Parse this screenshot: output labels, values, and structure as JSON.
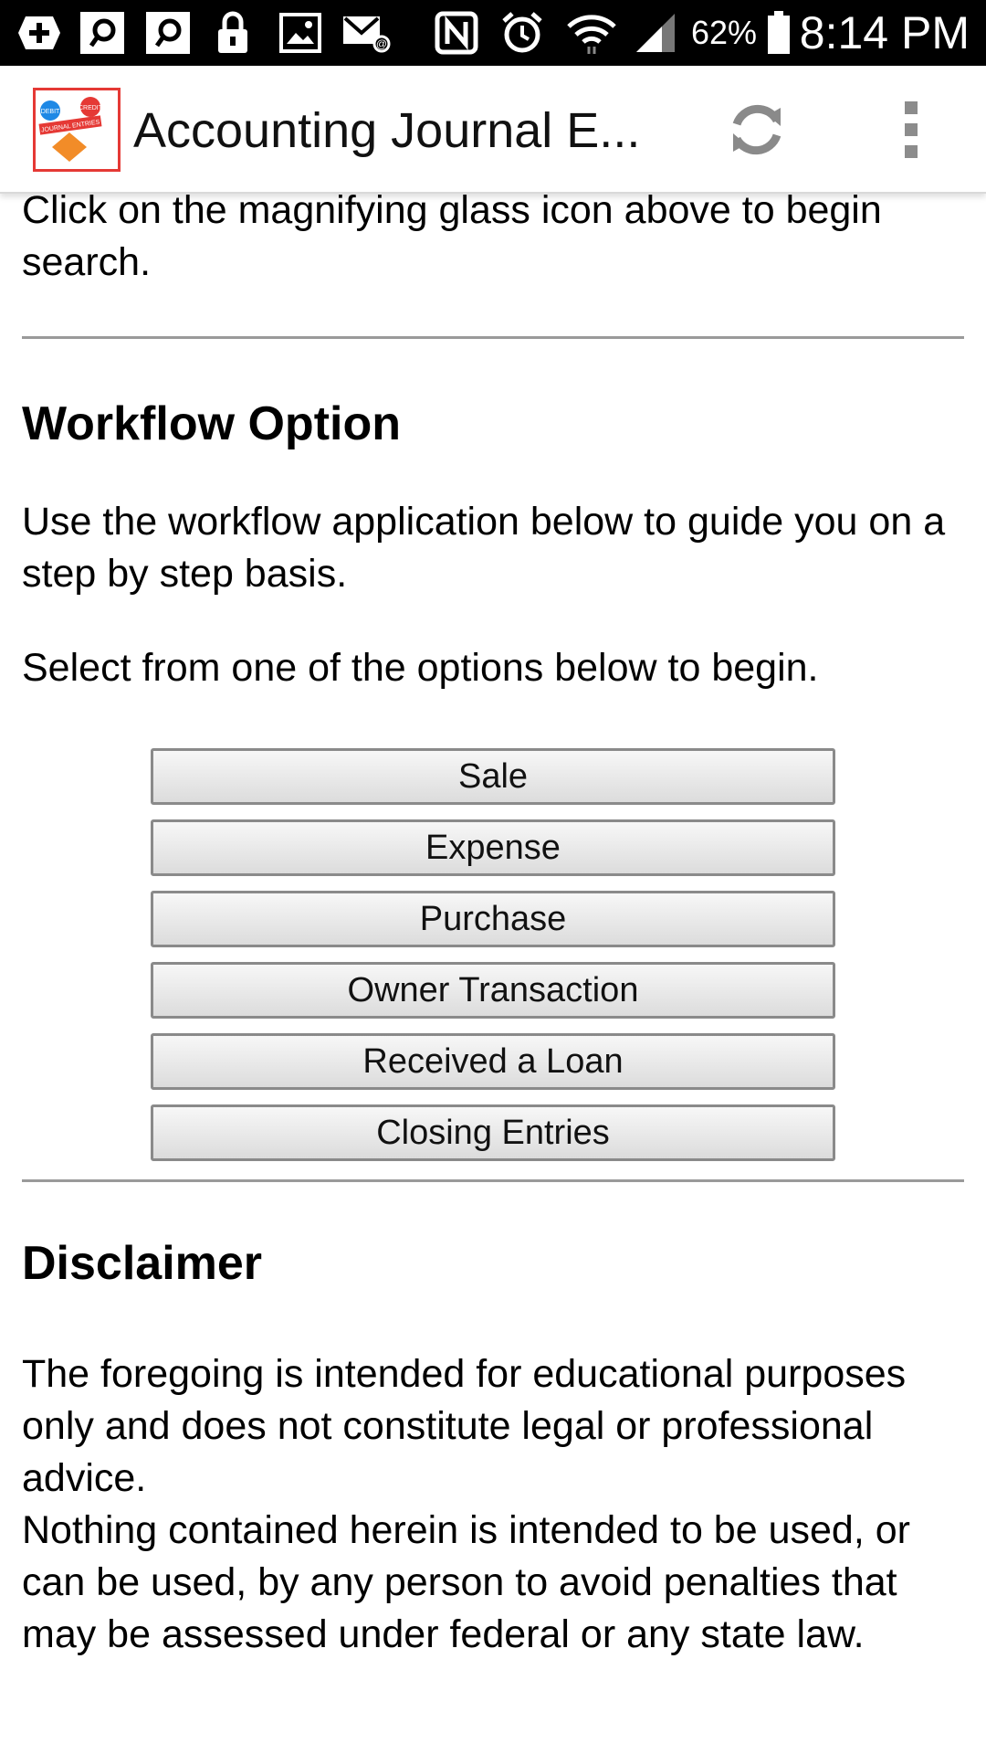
{
  "status_bar": {
    "battery_percent": "62%",
    "time": "8:14 PM",
    "icons": [
      "add-icon",
      "search-app-icon",
      "search-app-icon",
      "lock-icon",
      "image-icon",
      "mail-icon",
      "nfc-icon",
      "alarm-icon",
      "wifi-icon",
      "signal-icon",
      "battery-icon"
    ]
  },
  "app_bar": {
    "title": "Accounting Journal E...",
    "logo_text": "JOURNAL ENTRIES",
    "logo_badge_left": "DEBIT",
    "logo_badge_right": "CREDIT",
    "refresh_icon": "refresh-icon",
    "menu_icon": "overflow-menu-icon"
  },
  "intro": {
    "text": "Click on the magnifying glass icon above to begin search."
  },
  "workflow": {
    "heading": "Workflow Option",
    "description": "Use the workflow application below to guide you on a step by step basis.",
    "prompt": "Select from one of the options below to begin.",
    "options": [
      "Sale",
      "Expense",
      "Purchase",
      "Owner Transaction",
      "Received a Loan",
      "Closing Entries"
    ]
  },
  "disclaimer": {
    "heading": "Disclaimer",
    "paragraph1": "The foregoing is intended for educational purposes only and does not constitute legal or professional advice.",
    "paragraph2": "Nothing contained herein is intended to be used, or can be used, by any person to avoid penalties that may be assessed under federal or any state law."
  },
  "colors": {
    "status_bar_bg": "#000000",
    "logo_border": "#e53935",
    "logo_diamond": "#f28c28",
    "rule": "#9a9a9a"
  }
}
